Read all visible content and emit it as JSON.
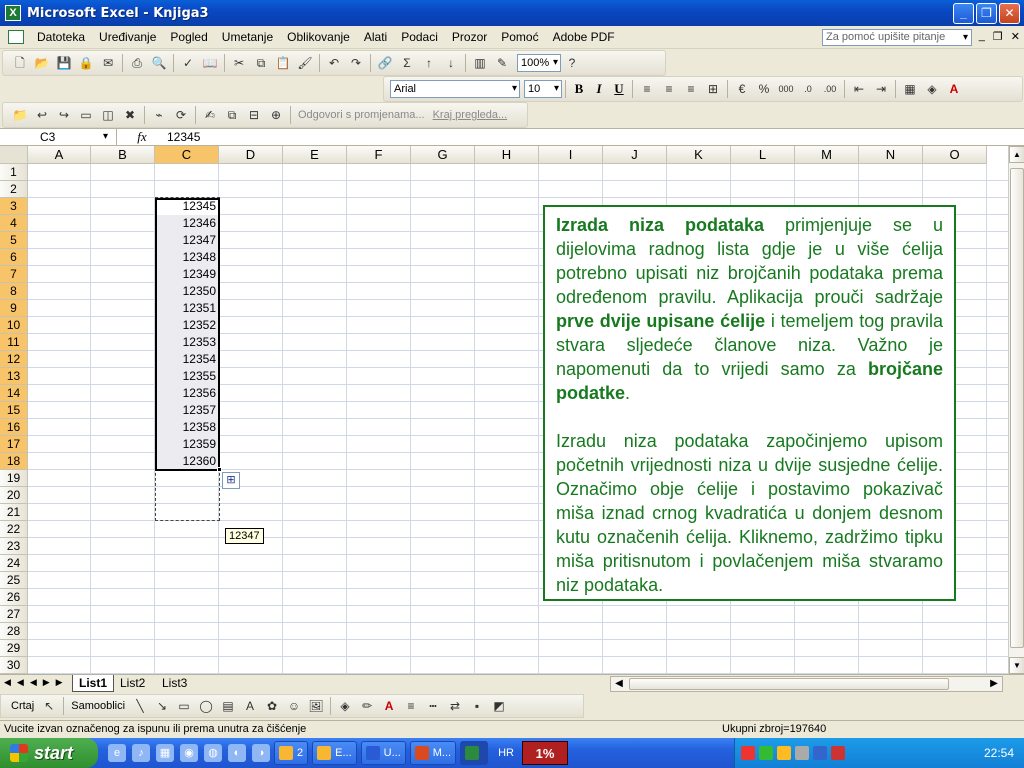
{
  "window": {
    "title": "Microsoft Excel - Knjiga3",
    "app_icon": "excel-icon"
  },
  "menu": {
    "items": [
      "Datoteka",
      "Uređivanje",
      "Pogled",
      "Umetanje",
      "Oblikovanje",
      "Alati",
      "Podaci",
      "Prozor",
      "Pomoć",
      "Adobe PDF"
    ],
    "help_placeholder": "Za pomoć upišite pitanje"
  },
  "standard_toolbar": {
    "zoom": "100%"
  },
  "format_toolbar": {
    "font": "Arial",
    "size": "10"
  },
  "review_toolbar": {
    "reply": "Odgovori s promjenama...",
    "end_review": "Kraj pregleda..."
  },
  "formula_bar": {
    "name_box": "C3",
    "fx": "fx",
    "value": "12345"
  },
  "columns": [
    "A",
    "B",
    "C",
    "D",
    "E",
    "F",
    "G",
    "H",
    "I",
    "J",
    "K",
    "L",
    "M",
    "N",
    "O"
  ],
  "active_column": "C",
  "rows": [
    "1",
    "2",
    "3",
    "4",
    "5",
    "6",
    "7",
    "8",
    "9",
    "10",
    "11",
    "12",
    "13",
    "14",
    "15",
    "16",
    "17",
    "18",
    "19",
    "20",
    "21",
    "22",
    "23",
    "24",
    "25",
    "26",
    "27",
    "28",
    "29",
    "30"
  ],
  "cells_c": [
    "12345",
    "12346",
    "12347",
    "12348",
    "12349",
    "12350",
    "12351",
    "12352",
    "12353",
    "12354",
    "12355",
    "12356",
    "12357",
    "12358",
    "12359",
    "12360"
  ],
  "tooltip": "12347",
  "textbox": {
    "p1_b1": "Izrada niza podataka",
    "p1_t1": " primjenjuje se u dijelovima radnog lista gdje je u više ćelija potrebno upisati niz brojčanih podataka prema određenom pravilu. Aplikacija prouči sadržaje ",
    "p1_b2": "prve dvije upisane ćelije",
    "p1_t2": " i temeljem tog pravila stvara sljedeće članove niza. Važno je napomenuti da to vrijedi samo za ",
    "p1_b3": "brojčane podatke",
    "p1_t3": ".",
    "p2": "Izradu niza podataka započinjemo upisom početnih vrijednosti niza u dvije susjedne ćelije. Označimo obje ćelije i postavimo pokazivač miša iznad crnog kvadratića u donjem desnom kutu označenih ćelija. Kliknemo, zadržimo tipku miša pritisnutom i povlačenjem miša stvaramo niz podataka."
  },
  "sheet_tabs": [
    "List1",
    "List2",
    "List3"
  ],
  "drawing_toolbar": {
    "draw": "Crtaj",
    "autoshapes": "Samooblici"
  },
  "status": {
    "message": "Vucite izvan označenog za ispunu ili prema unutra za čišćenje",
    "sum": "Ukupni zbroj=197640"
  },
  "taskbar": {
    "start": "start",
    "items": [
      "2",
      "E...",
      "U...",
      "M...",
      ""
    ],
    "lang": "HR",
    "cpu": "1%",
    "clock": "22:54"
  }
}
